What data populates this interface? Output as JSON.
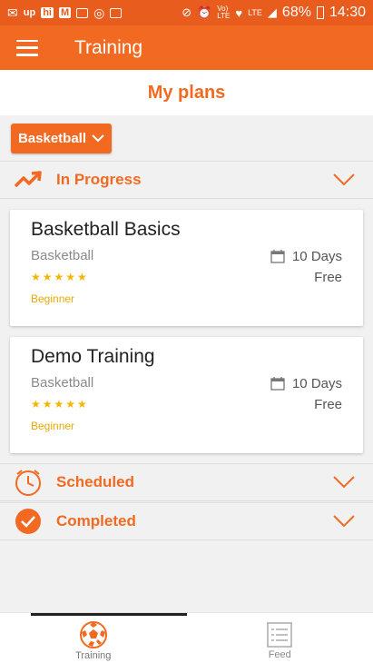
{
  "status_bar": {
    "left_icons": [
      "up",
      "hi",
      "M",
      "image",
      "whatsapp",
      "grid"
    ],
    "battery": "68%",
    "time": "14:30"
  },
  "app_bar": {
    "title": "Training"
  },
  "plans": {
    "title": "My plans"
  },
  "filter": {
    "label": "Basketball"
  },
  "sections": {
    "in_progress": "In Progress",
    "scheduled": "Scheduled",
    "completed": "Completed"
  },
  "cards": [
    {
      "title": "Basketball Basics",
      "sport": "Basketball",
      "stars": "★★★★★",
      "rating": 5,
      "level": "Beginner",
      "days": "10 Days",
      "price": "Free"
    },
    {
      "title": "Demo Training",
      "sport": "Basketball",
      "stars": "★★★★★",
      "rating": 5,
      "level": "Beginner",
      "days": "10 Days",
      "price": "Free"
    }
  ],
  "nav": {
    "training": "Training",
    "feed": "Feed"
  },
  "colors": {
    "accent": "#f26a21",
    "status_bar": "#e85c1e",
    "star": "#f5b400"
  }
}
